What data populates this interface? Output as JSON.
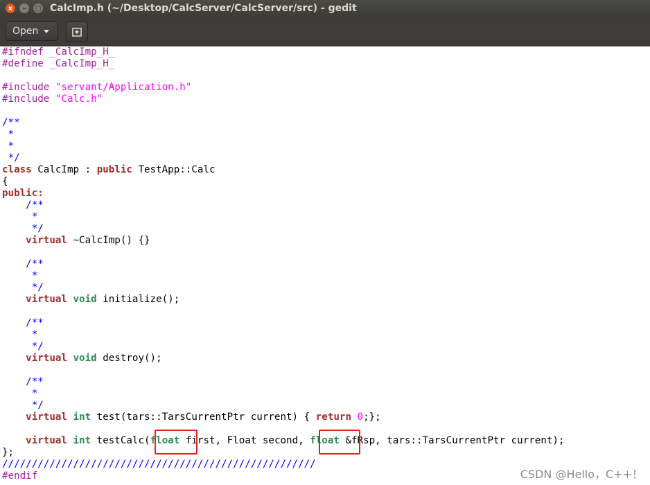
{
  "window": {
    "title": "CalcImp.h (~/Desktop/CalcServer/CalcServer/src) - gedit",
    "close_glyph": "x",
    "minimize_glyph": "–",
    "maximize_glyph": "□"
  },
  "toolbar": {
    "open_label": "Open"
  },
  "code": {
    "l1": "#ifndef _CalcImp_H_",
    "l2": "#define _CalcImp_H_",
    "l4a": "#include ",
    "l4b": "\"servant/Application.h\"",
    "l5a": "#include ",
    "l5b": "\"Calc.h\"",
    "l7": "/**",
    "l8": " *",
    "l9": " *",
    "l10": " */",
    "l11a": "class",
    "l11b": " CalcImp : ",
    "l11c": "public",
    "l11d": " TestApp::Calc",
    "l12": "{",
    "l13": "public:",
    "l14": "    /**",
    "l15": "     *",
    "l16": "     */",
    "l17a": "    ",
    "l17b": "virtual",
    "l17c": " ~CalcImp() {}",
    "l19": "    /**",
    "l20": "     *",
    "l21": "     */",
    "l22a": "    ",
    "l22b": "virtual",
    "l22c": " ",
    "l22d": "void",
    "l22e": " initialize();",
    "l24": "    /**",
    "l25": "     *",
    "l26": "     */",
    "l27a": "    ",
    "l27b": "virtual",
    "l27c": " ",
    "l27d": "void",
    "l27e": " destroy();",
    "l29": "    /**",
    "l30": "     *",
    "l31": "     */",
    "l32a": "    ",
    "l32b": "virtual",
    "l32c": " ",
    "l32d": "int",
    "l32e": " test(tars::TarsCurrentPtr current) { ",
    "l32f": "return",
    "l32g": " ",
    "l32h": "0",
    "l32i": ";};",
    "l34a": "    ",
    "l34b": "virtual",
    "l34c": " ",
    "l34d": "int",
    "l34e": " testCalc(",
    "l34f": "float",
    "l34g": " first, Float second, ",
    "l34h": "float",
    "l34i": " &fRsp, tars::TarsCurrentPtr current);",
    "l35": "};",
    "l36": "/////////////////////////////////////////////////////",
    "l37": "#endif"
  },
  "watermark": "CSDN @Hello，C++！"
}
